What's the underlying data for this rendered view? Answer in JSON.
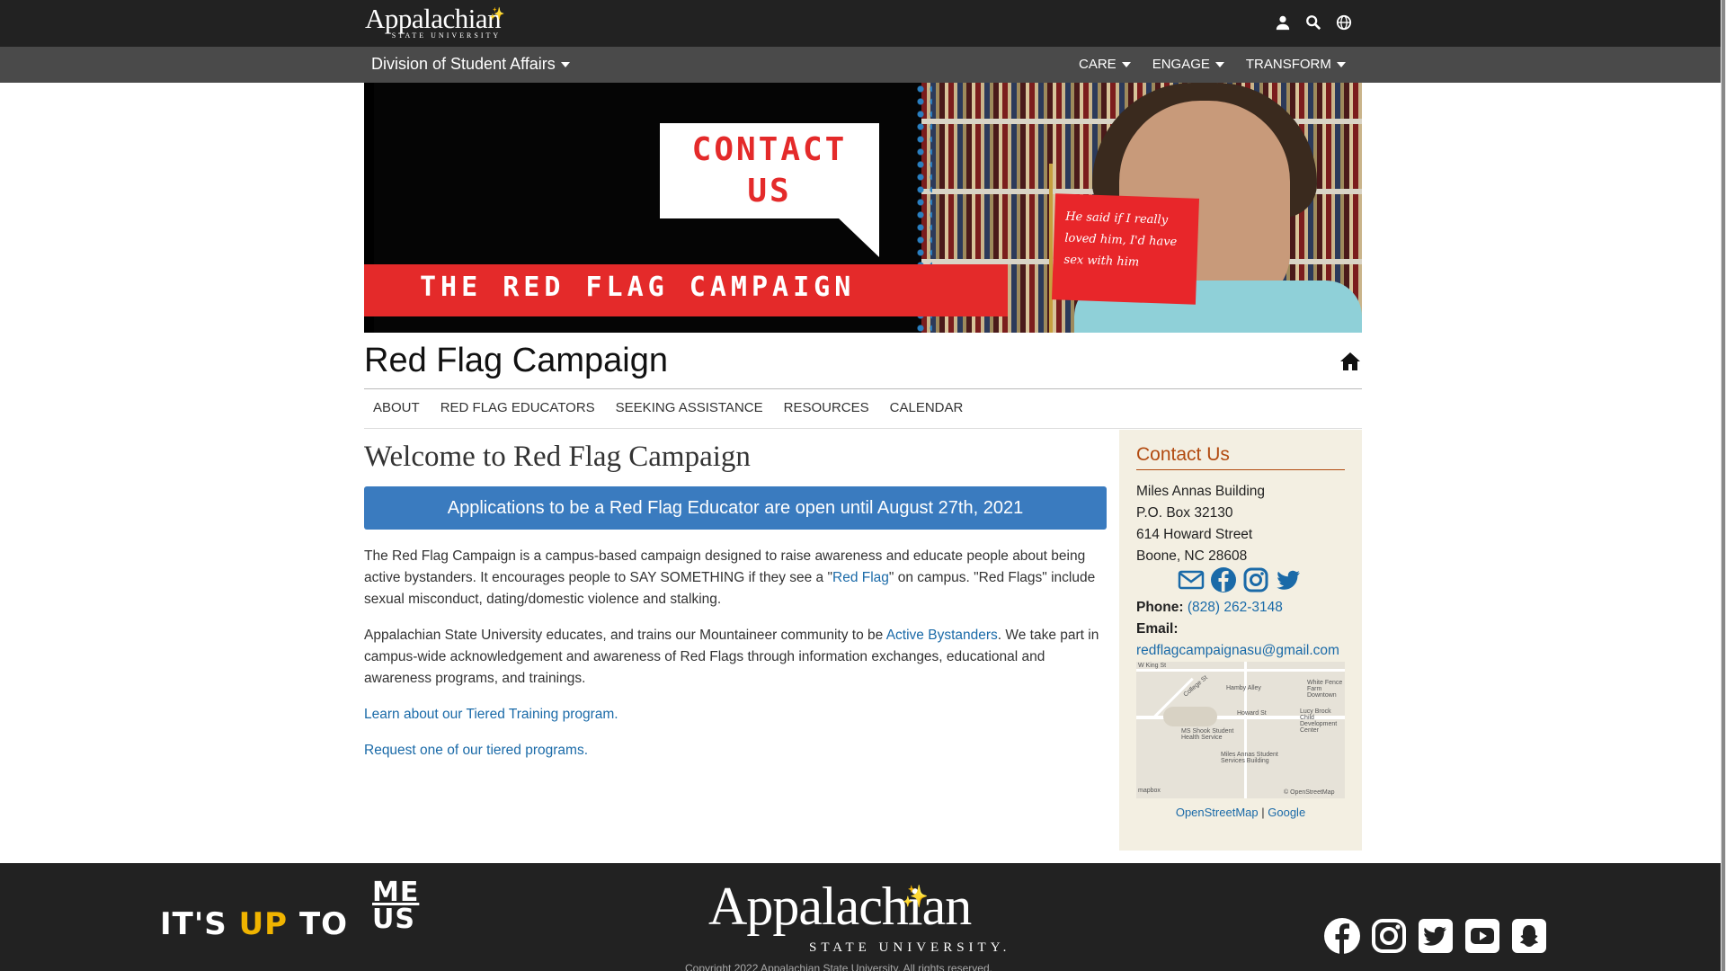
{
  "header": {
    "logo_text": "Appalachian",
    "logo_sub": "STATE UNIVERSITY",
    "icons": [
      "user-icon",
      "search-icon",
      "globe-icon"
    ]
  },
  "division": {
    "label": "Division of Student Affairs",
    "nav": [
      {
        "label": "CARE"
      },
      {
        "label": "ENGAGE"
      },
      {
        "label": "TRANSFORM"
      }
    ]
  },
  "banner": {
    "bubble_line1": "CONTACT",
    "bubble_line2": "US",
    "bar_text": "THE RED FLAG CAMPAIGN",
    "flag_text": "He said if I really loved him, I'd have sex with him"
  },
  "site": {
    "title": "Red Flag Campaign",
    "subnav": [
      "ABOUT",
      "RED FLAG EDUCATORS",
      "SEEKING ASSISTANCE",
      "RESOURCES",
      "CALENDAR"
    ]
  },
  "main": {
    "heading": "Welcome to Red Flag Campaign",
    "announcement": "Applications to be a Red Flag Educator are open until August 27th, 2021",
    "p1_a": "The Red Flag Campaign is a campus-based campaign designed to raise awareness and educate people about being active bystanders. It encourages people to SAY SOMETHING if they see a \"",
    "p1_link": "Red Flag",
    "p1_b": "\" on campus. \"Red Flags\" include sexual misconduct, dating/domestic violence and stalking.",
    "p2_a": "Appalachian State University educates, and trains our Mountaineer community to be ",
    "p2_link": "Active Bystanders",
    "p2_b": ". We take part in campus-wide acknowledgement and awareness of Red Flags through information exchanges, educational and awareness programs, and trainings.",
    "link1": "Learn about our Tiered Training program.",
    "link2": "Request one of our tiered programs."
  },
  "sidebar": {
    "heading": "Contact Us",
    "address": [
      "Miles Annas Building",
      "P.O. Box 32130",
      "614 Howard Street",
      "Boone, NC 28608"
    ],
    "social_icons": [
      "email-icon",
      "facebook-icon",
      "instagram-icon",
      "twitter-icon"
    ],
    "phone_label": "Phone:",
    "phone": "(828) 262-3148",
    "email_label": "Email:",
    "email": "redflagcampaignasu@gmail.com",
    "map_labels": {
      "king_st": "W King St",
      "college_st": "College St",
      "hamby": "Hamby Alley",
      "howard": "Howard St",
      "white_fence": "White Fence Farm Downtown",
      "lucy": "Lucy Brock Child Development Center",
      "shook": "MS Shook Student Health Service",
      "miles": "Miles Annas Student Services Building",
      "attrib_left": "mapbox",
      "attrib_right": "© OpenStreetMap"
    },
    "map_link1": "OpenStreetMap",
    "map_sep": "|",
    "map_link2": "Google"
  },
  "footer": {
    "slogan_a": "IT'S ",
    "slogan_up": "UP",
    "slogan_b": " TO",
    "slogan_me": "ME",
    "slogan_us": "US",
    "logo_text": "Appalachian",
    "logo_sub": "STATE UNIVERSITY.",
    "copyright": "Copyright 2022 Appalachian State University. All rights reserved.",
    "social_icons": [
      "facebook-icon",
      "instagram-icon",
      "twitter-icon",
      "youtube-icon",
      "snapchat-icon"
    ]
  }
}
